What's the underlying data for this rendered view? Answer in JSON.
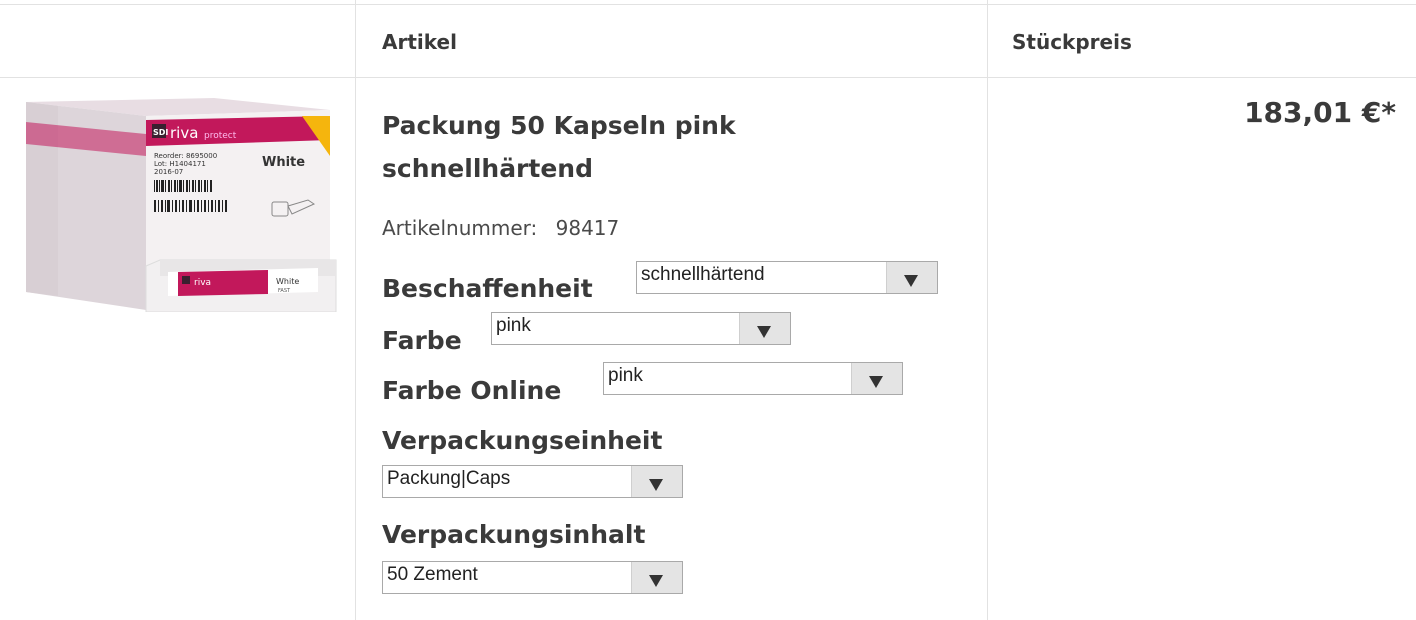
{
  "table": {
    "header_artikel": "Artikel",
    "header_stueckpreis": "Stückpreis"
  },
  "product": {
    "image_icon": "product-box-image",
    "title": "Packung 50 Kapseln pink schnellhärtend",
    "article_number_label": "Artikelnummer:",
    "article_number": "98417",
    "price": "183,01 €*"
  },
  "options": {
    "beschaffenheit": {
      "label": "Beschaffenheit",
      "value": "schnellhärtend"
    },
    "farbe": {
      "label": "Farbe",
      "value": "pink"
    },
    "farbe_online": {
      "label": "Farbe Online",
      "value": "pink"
    },
    "verpackungseinheit": {
      "label": "Verpackungseinheit",
      "value": "Packung|Caps"
    },
    "verpackungsinhalt": {
      "label": "Verpackungsinhalt",
      "value": "50 Zement"
    }
  },
  "image_text": {
    "brand": "riva",
    "brand_sub": "protect",
    "logo": "SDI",
    "shade": "White",
    "reorder": "Reorder: 8695000",
    "lot": "Lot: H1404171",
    "expiry": "2016-07",
    "fast": "FAST"
  },
  "colors": {
    "brand_magenta": "#c2185b",
    "border": "#e2e2e2",
    "text": "#3a3a3a"
  }
}
